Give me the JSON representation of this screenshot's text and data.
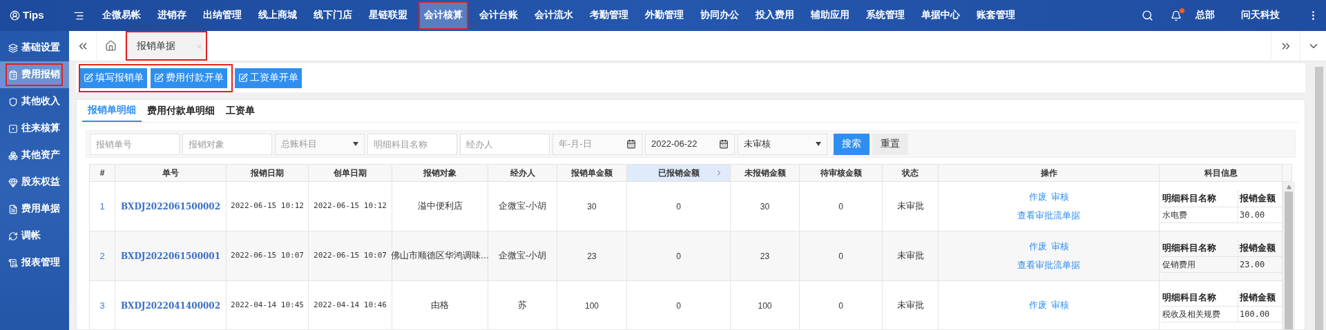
{
  "top_nav": {
    "brand": "Tips",
    "items": [
      {
        "label": "企微易帐",
        "selected": false,
        "highlighted": false
      },
      {
        "label": "进销存",
        "selected": false,
        "highlighted": false
      },
      {
        "label": "出纳管理",
        "selected": false,
        "highlighted": false
      },
      {
        "label": "线上商城",
        "selected": false,
        "highlighted": false
      },
      {
        "label": "线下门店",
        "selected": false,
        "highlighted": false
      },
      {
        "label": "星链联盟",
        "selected": false,
        "highlighted": false
      },
      {
        "label": "会计核算",
        "selected": true,
        "highlighted": true
      },
      {
        "label": "会计台账",
        "selected": false,
        "highlighted": false
      },
      {
        "label": "会计流水",
        "selected": false,
        "highlighted": false
      },
      {
        "label": "考勤管理",
        "selected": false,
        "highlighted": false
      },
      {
        "label": "外勤管理",
        "selected": false,
        "highlighted": false
      },
      {
        "label": "协同办公",
        "selected": false,
        "highlighted": false
      },
      {
        "label": "投入费用",
        "selected": false,
        "highlighted": false
      },
      {
        "label": "辅助应用",
        "selected": false,
        "highlighted": false
      },
      {
        "label": "系统管理",
        "selected": false,
        "highlighted": false
      },
      {
        "label": "单据中心",
        "selected": false,
        "highlighted": false
      },
      {
        "label": "账套管理",
        "selected": false,
        "highlighted": false
      }
    ],
    "notification_dot": true,
    "branch": "总部",
    "company": "问天科技"
  },
  "sidebar": {
    "items": [
      {
        "label": "基础设置",
        "selected": false,
        "highlighted": false
      },
      {
        "label": "费用报销",
        "selected": true,
        "highlighted": true
      },
      {
        "label": "其他收入",
        "selected": false,
        "highlighted": false
      },
      {
        "label": "往来核算",
        "selected": false,
        "highlighted": false
      },
      {
        "label": "其他资产",
        "selected": false,
        "highlighted": false
      },
      {
        "label": "股东权益",
        "selected": false,
        "highlighted": false
      },
      {
        "label": "费用单据",
        "selected": false,
        "highlighted": false
      },
      {
        "label": "调帐",
        "selected": false,
        "highlighted": false
      },
      {
        "label": "报表管理",
        "selected": false,
        "highlighted": false
      }
    ]
  },
  "page_tabs": [
    {
      "label": "报销单据",
      "selected": true,
      "highlighted": true
    }
  ],
  "toolbar": {
    "groups": [
      {
        "highlighted": true,
        "buttons": [
          "填写报销单",
          "费用付款开单"
        ]
      },
      {
        "highlighted": false,
        "buttons": [
          "工资单开单"
        ]
      }
    ]
  },
  "content_tabs": [
    {
      "label": "报销单明细",
      "selected": true
    },
    {
      "label": "费用付款单明细",
      "selected": false
    },
    {
      "label": "工资单",
      "selected": false
    }
  ],
  "filters": [
    {
      "kind": "text",
      "placeholder": "报销单号"
    },
    {
      "kind": "text",
      "placeholder": "报销对象"
    },
    {
      "kind": "select",
      "placeholder": "总账科目"
    },
    {
      "kind": "text",
      "placeholder": "明细科目名称"
    },
    {
      "kind": "text",
      "placeholder": "经办人"
    },
    {
      "kind": "date",
      "placeholder": "年-月-日"
    },
    {
      "kind": "date",
      "value": "2022-06-22"
    },
    {
      "kind": "select",
      "value": "未审核"
    }
  ],
  "filter_buttons": {
    "search": "搜索",
    "reset": "重置"
  },
  "table": {
    "columns": [
      {
        "label": "#",
        "selected": false
      },
      {
        "label": "单号",
        "selected": false
      },
      {
        "label": "报销日期",
        "selected": false
      },
      {
        "label": "创单日期",
        "selected": false
      },
      {
        "label": "报销对象",
        "selected": false
      },
      {
        "label": "经办人",
        "selected": false
      },
      {
        "label": "报销单金额",
        "selected": false
      },
      {
        "label": "已报销金额",
        "selected": true
      },
      {
        "label": "未报销金额",
        "selected": false
      },
      {
        "label": "待审核金额",
        "selected": false
      },
      {
        "label": "状态",
        "selected": false
      },
      {
        "label": "操作",
        "selected": false
      },
      {
        "label": "科目信息",
        "selected": false
      }
    ],
    "rows": [
      {
        "index": "1",
        "number": "BXDJ2022061500002",
        "date": "2022-06-15 10:12",
        "created": "2022-06-15 10:12",
        "target": "溢中便利店",
        "handler": "企微宝-小胡",
        "amount": "30",
        "paid": "0",
        "unpaid": "30",
        "pending": "0",
        "status": "未审批",
        "actions": [
          "作废",
          "审核"
        ],
        "links": [
          "查看审批流单据"
        ],
        "details": {
          "columns": [
            "明细科目名称",
            "报销金额"
          ],
          "rows": [
            [
              "水电费",
              "30.00"
            ]
          ]
        }
      },
      {
        "index": "2",
        "number": "BXDJ2022061500001",
        "date": "2022-06-15 10:07",
        "created": "2022-06-15 10:07",
        "target": "佛山市顺德区华鸿调味…",
        "handler": "企微宝-小胡",
        "amount": "23",
        "paid": "0",
        "unpaid": "23",
        "pending": "0",
        "status": "未审批",
        "actions": [
          "作废",
          "审核"
        ],
        "links": [
          "查看审批流单据"
        ],
        "details": {
          "columns": [
            "明细科目名称",
            "报销金额"
          ],
          "rows": [
            [
              "促销费用",
              "23.00"
            ]
          ]
        }
      },
      {
        "index": "3",
        "number": "BXDJ2022041400002",
        "date": "2022-04-14 10:45",
        "created": "2022-04-14 10:46",
        "target": "由格",
        "handler": "苏",
        "amount": "100",
        "paid": "0",
        "unpaid": "100",
        "pending": "0",
        "status": "未审批",
        "actions": [
          "作废",
          "审核"
        ],
        "links": [],
        "details": {
          "columns": [
            "明细科目名称",
            "报销金额"
          ],
          "rows": [
            [
              "税收及相关规费",
              "100.00"
            ]
          ]
        }
      }
    ]
  }
}
